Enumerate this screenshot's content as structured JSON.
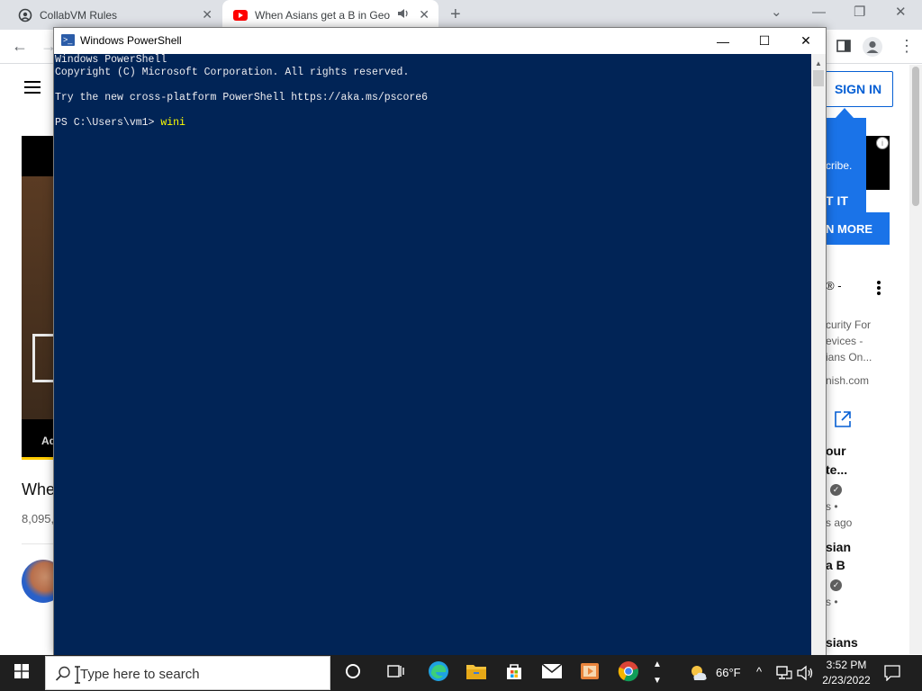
{
  "browser": {
    "tabs": [
      {
        "title": "CollabVM Rules",
        "icon": "collabvm-icon"
      },
      {
        "title": "When Asians get a B in Geog",
        "icon": "youtube-icon",
        "audio": true
      }
    ],
    "new_tab": "+",
    "window_controls": {
      "dropdown": "⌄",
      "minimize": "—",
      "restore": "❐",
      "close": "✕"
    },
    "toolbar": {
      "back": "←",
      "forward": "→",
      "menu": "⋮"
    }
  },
  "youtube": {
    "sign_in": "SIGN IN",
    "video_ad_label": "Ad",
    "video_title": "Whe",
    "views": "8,095,",
    "promo_text": "cribe.",
    "promo_cta": "T IT",
    "learn_more": "N MORE",
    "ad_info": "i",
    "sidebar": {
      "ad_title": "® -",
      "ad_desc_1": "curity For",
      "ad_desc_2": "evices -",
      "ad_desc_3": "ians On...",
      "ad_domain": "nish.com",
      "item1_title_1": "our",
      "item1_title_2": "te...",
      "item1_meta_1": "s •",
      "item1_meta_2": "s ago",
      "item2_title_1": "sian",
      "item2_title_2": "a B",
      "item2_meta_1": "s •",
      "item3_title_1": "sians"
    }
  },
  "powershell": {
    "title": "Windows PowerShell",
    "controls": {
      "minimize": "—",
      "maximize": "☐",
      "close": "✕"
    },
    "lines": [
      "Windows PowerShell",
      "Copyright (C) Microsoft Corporation. All rights reserved.",
      "",
      "Try the new cross-platform PowerShell https://aka.ms/pscore6",
      ""
    ],
    "prompt": "PS C:\\Users\\vm1> ",
    "typed": "wini"
  },
  "taskbar": {
    "search_placeholder": "Type here to search",
    "apps": [
      "cortana-icon",
      "task-view-icon",
      "edge-icon",
      "file-explorer-icon",
      "store-icon",
      "mail-icon",
      "media-player-icon",
      "chrome-icon"
    ],
    "weather": "66°F",
    "time": "3:52 PM",
    "date": "2/23/2022"
  },
  "colors": {
    "console_bg": "#012456",
    "console_text": "#eeedf0",
    "typed_text": "#ffff00",
    "youtube_blue": "#065fd4",
    "taskbar": "#1f1f1f"
  }
}
